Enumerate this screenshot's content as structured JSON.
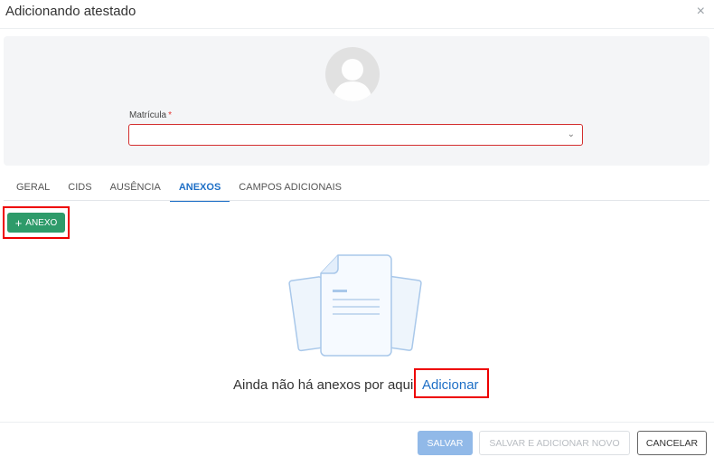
{
  "dialog": {
    "title": "Adicionando atestado",
    "close_icon": "×"
  },
  "form": {
    "matricula_label": "Matrícula",
    "required_mark": "*",
    "matricula_value": "",
    "chevron": "⌄"
  },
  "tabs": [
    {
      "label": "GERAL",
      "active": false
    },
    {
      "label": "CIDS",
      "active": false
    },
    {
      "label": "AUSÊNCIA",
      "active": false
    },
    {
      "label": "ANEXOS",
      "active": true
    },
    {
      "label": "CAMPOS ADICIONAIS",
      "active": false
    }
  ],
  "anexos": {
    "add_button_label": "ANEXO",
    "add_button_icon": "+",
    "empty_message": "Ainda não há anexos por aqui",
    "add_link": "Adicionar"
  },
  "footer": {
    "save": "SALVAR",
    "save_and_new": "SALVAR E ADICIONAR NOVO",
    "cancel": "CANCELAR"
  },
  "colors": {
    "accent": "#1e6fc6",
    "success_button": "#2e9b6a",
    "highlight": "#ee0000",
    "error_border": "#d32f2f"
  }
}
